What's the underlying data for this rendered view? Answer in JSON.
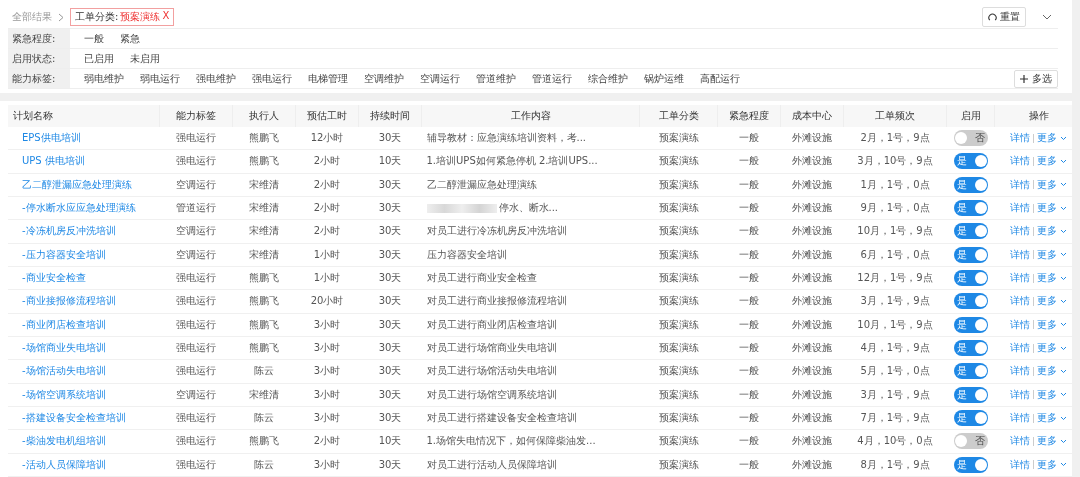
{
  "breadcrumb": {
    "root": "全部结果",
    "tag_label": "工单分类:",
    "tag_value": "预案演练",
    "tag_close": "X"
  },
  "reset_button": "重置",
  "filters": [
    {
      "label": "紧急程度:",
      "options": [
        "一般",
        "紧急"
      ]
    },
    {
      "label": "启用状态:",
      "options": [
        "已启用",
        "未启用"
      ]
    },
    {
      "label": "能力标签:",
      "options": [
        "弱电维护",
        "弱电运行",
        "强电维护",
        "强电运行",
        "电梯管理",
        "空调维护",
        "空调运行",
        "管道维护",
        "管道运行",
        "综合维护",
        "锅炉运维",
        "高配运行"
      ],
      "multi_button": "多选"
    }
  ],
  "table": {
    "columns": [
      "计划名称",
      "能力标签",
      "执行人",
      "预估工时",
      "持续时间",
      "工作内容",
      "工单分类",
      "紧急程度",
      "成本中心",
      "工单频次",
      "启用",
      "操作"
    ],
    "rows": [
      {
        "name": "EPS供电培训",
        "tag": "强电运行",
        "person": "熊鹏飞",
        "hours": "12小时",
        "duration": "30天",
        "content": "辅导教材：应急演练培训资料，考...",
        "category": "预案演练",
        "urgency": "一般",
        "cost": "外滩设施",
        "freq": "2月，1号，9点",
        "on": false,
        "switch_text": "否",
        "detail": "详情",
        "more": "更多"
      },
      {
        "name": "UPS 供电培训",
        "tag": "强电运行",
        "person": "熊鹏飞",
        "hours": "2小时",
        "duration": "10天",
        "content": "1.培训UPS如何紧急停机 2.培训UPS...",
        "category": "预案演练",
        "urgency": "一般",
        "cost": "外滩设施",
        "freq": "3月，10号，9点",
        "on": true,
        "switch_text": "是",
        "detail": "详情",
        "more": "更多"
      },
      {
        "name": "乙二醇泄漏应急处理演练",
        "tag": "空调运行",
        "person": "宋维清",
        "hours": "2小时",
        "duration": "30天",
        "content": "乙二醇泄漏应急处理演练",
        "category": "预案演练",
        "urgency": "一般",
        "cost": "外滩设施",
        "freq": "1月，1号，0点",
        "on": true,
        "switch_text": "是",
        "detail": "详情",
        "more": "更多"
      },
      {
        "name": "-停水断水应应急处理演练",
        "tag": "管道运行",
        "person": "宋维清",
        "hours": "2小时",
        "duration": "30天",
        "content": "停水、断水...",
        "redacted": true,
        "category": "预案演练",
        "urgency": "一般",
        "cost": "外滩设施",
        "freq": "9月，1号，0点",
        "on": true,
        "switch_text": "是",
        "detail": "详情",
        "more": "更多"
      },
      {
        "name": "-冷冻机房反冲洗培训",
        "tag": "空调运行",
        "person": "宋维清",
        "hours": "2小时",
        "duration": "30天",
        "content": "对员工进行冷冻机房反冲洗培训",
        "category": "预案演练",
        "urgency": "一般",
        "cost": "外滩设施",
        "freq": "10月，1号，9点",
        "on": true,
        "switch_text": "是",
        "detail": "详情",
        "more": "更多"
      },
      {
        "name": "-压力容器安全培训",
        "tag": "空调运行",
        "person": "宋维清",
        "hours": "1小时",
        "duration": "30天",
        "content": "压力容器安全培训",
        "category": "预案演练",
        "urgency": "一般",
        "cost": "外滩设施",
        "freq": "6月，1号，0点",
        "on": true,
        "switch_text": "是",
        "detail": "详情",
        "more": "更多"
      },
      {
        "name": "-商业安全检查",
        "tag": "强电运行",
        "person": "熊鹏飞",
        "hours": "1小时",
        "duration": "30天",
        "content": "对员工进行商业安全检查",
        "category": "预案演练",
        "urgency": "一般",
        "cost": "外滩设施",
        "freq": "12月，1号，9点",
        "on": true,
        "switch_text": "是",
        "detail": "详情",
        "more": "更多"
      },
      {
        "name": "-商业接报修流程培训",
        "tag": "强电运行",
        "person": "熊鹏飞",
        "hours": "20小时",
        "duration": "30天",
        "content": "对员工进行商业接报修流程培训",
        "category": "预案演练",
        "urgency": "一般",
        "cost": "外滩设施",
        "freq": "3月，1号，9点",
        "on": true,
        "switch_text": "是",
        "detail": "详情",
        "more": "更多"
      },
      {
        "name": "-商业闭店检查培训",
        "tag": "强电运行",
        "person": "熊鹏飞",
        "hours": "3小时",
        "duration": "30天",
        "content": "对员工进行商业闭店检查培训",
        "category": "预案演练",
        "urgency": "一般",
        "cost": "外滩设施",
        "freq": "10月，1号，9点",
        "on": true,
        "switch_text": "是",
        "detail": "详情",
        "more": "更多"
      },
      {
        "name": "-场馆商业失电培训",
        "tag": "强电运行",
        "person": "熊鹏飞",
        "hours": "3小时",
        "duration": "30天",
        "content": "对员工进行场馆商业失电培训",
        "category": "预案演练",
        "urgency": "一般",
        "cost": "外滩设施",
        "freq": "4月，1号，9点",
        "on": true,
        "switch_text": "是",
        "detail": "详情",
        "more": "更多"
      },
      {
        "name": "-场馆活动失电培训",
        "tag": "强电运行",
        "person": "陈云",
        "hours": "3小时",
        "duration": "30天",
        "content": "对员工进行场馆活动失电培训",
        "category": "预案演练",
        "urgency": "一般",
        "cost": "外滩设施",
        "freq": "5月，1号，0点",
        "on": true,
        "switch_text": "是",
        "detail": "详情",
        "more": "更多"
      },
      {
        "name": "-场馆空调系统培训",
        "tag": "空调运行",
        "person": "宋维清",
        "hours": "3小时",
        "duration": "30天",
        "content": "对员工进行场馆空调系统培训",
        "category": "预案演练",
        "urgency": "一般",
        "cost": "外滩设施",
        "freq": "3月，1号，9点",
        "on": true,
        "switch_text": "是",
        "detail": "详情",
        "more": "更多"
      },
      {
        "name": "-搭建设备安全检查培训",
        "tag": "强电运行",
        "person": "陈云",
        "hours": "3小时",
        "duration": "30天",
        "content": "对员工进行搭建设备安全检查培训",
        "category": "预案演练",
        "urgency": "一般",
        "cost": "外滩设施",
        "freq": "7月，1号，9点",
        "on": true,
        "switch_text": "是",
        "detail": "详情",
        "more": "更多"
      },
      {
        "name": "-柴油发电机组培训",
        "tag": "强电运行",
        "person": "熊鹏飞",
        "hours": "2小时",
        "duration": "10天",
        "content": "1.场馆失电情况下，如何保障柴油发...",
        "category": "预案演练",
        "urgency": "一般",
        "cost": "外滩设施",
        "freq": "4月，10号，0点",
        "on": false,
        "switch_text": "否",
        "detail": "详情",
        "more": "更多"
      },
      {
        "name": "-活动人员保障培训",
        "tag": "强电运行",
        "person": "陈云",
        "hours": "3小时",
        "duration": "30天",
        "content": "对员工进行活动人员保障培训",
        "category": "预案演练",
        "urgency": "一般",
        "cost": "外滩设施",
        "freq": "8月，1号，9点",
        "on": true,
        "switch_text": "是",
        "detail": "详情",
        "more": "更多"
      }
    ]
  }
}
